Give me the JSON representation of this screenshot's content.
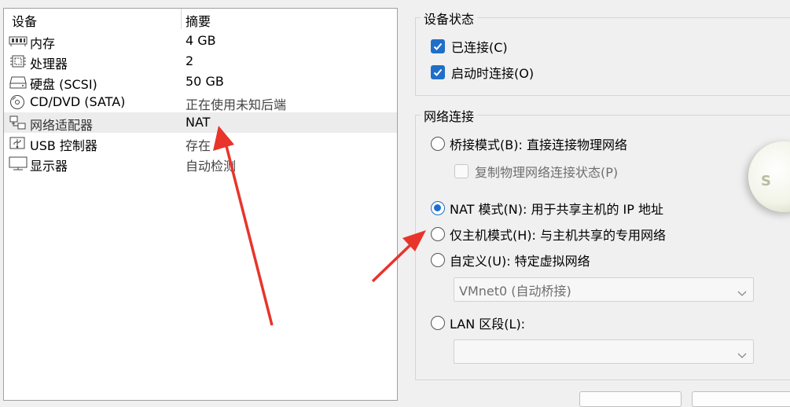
{
  "device_table": {
    "col_device": "设备",
    "col_summary": "摘要",
    "rows": [
      {
        "icon": "memory-icon",
        "name": "内存",
        "summary": "4 GB"
      },
      {
        "icon": "processor-icon",
        "name": "处理器",
        "summary": "2"
      },
      {
        "icon": "hard-disk-icon",
        "name": "硬盘 (SCSI)",
        "summary": "50 GB"
      },
      {
        "icon": "cd-dvd-icon",
        "name": "CD/DVD (SATA)",
        "summary": "正在使用未知后端"
      },
      {
        "icon": "network-adapter-icon",
        "name": "网络适配器",
        "summary": "NAT"
      },
      {
        "icon": "usb-icon",
        "name": "USB 控制器",
        "summary": "存在"
      },
      {
        "icon": "display-icon",
        "name": "显示器",
        "summary": "自动检测"
      }
    ],
    "selected_index": 4
  },
  "device_status": {
    "title": "设备状态",
    "connected_label": "已连接(C)",
    "connected_checked": true,
    "connect_at_poweron_label": "启动时连接(O)",
    "connect_at_poweron_checked": true
  },
  "network_connection": {
    "title": "网络连接",
    "bridged_label": "桥接模式(B): 直接连接物理网络",
    "replicate_label": "复制物理网络连接状态(P)",
    "nat_label": "NAT 模式(N): 用于共享主机的 IP 地址",
    "host_only_label": "仅主机模式(H): 与主机共享的专用网络",
    "custom_label": "自定义(U): 特定虚拟网络",
    "custom_select_value": "VMnet0 (自动桥接)",
    "lan_segment_label": "LAN 区段(L):",
    "lan_select_value": "",
    "selected_mode": "nat"
  },
  "colors": {
    "accent": "#1f6fc8",
    "annotation_arrow": "#e8342a",
    "selected_row": "#ececec"
  }
}
